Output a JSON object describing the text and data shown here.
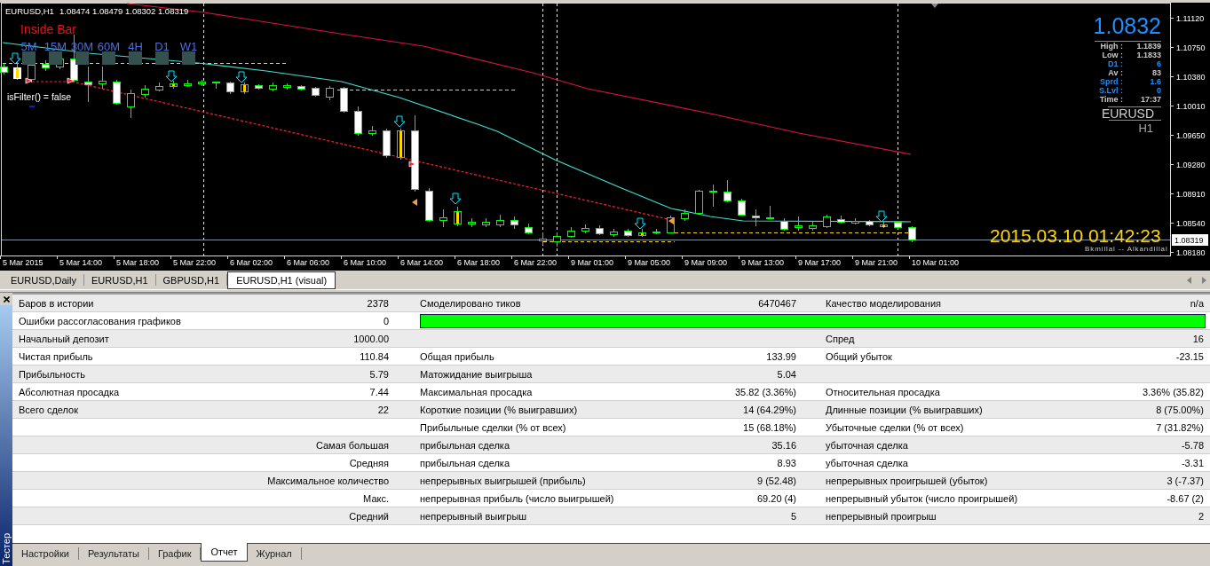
{
  "chart": {
    "symbol": "EURUSD,H1",
    "ohlc": "1.08474 1.08479 1.08302 1.08319",
    "indicator_title": "Inside Bar",
    "timeframes": [
      {
        "label": "5M"
      },
      {
        "label": "15M"
      },
      {
        "label": "30M"
      },
      {
        "label": "60M"
      },
      {
        "label": "4H"
      },
      {
        "label": "D1"
      },
      {
        "label": "W1"
      }
    ],
    "filter_status": "isFilter() = false",
    "info_panel": {
      "price": "1.0832",
      "rows": [
        {
          "label": "High :",
          "value": "1.1839",
          "color": "#c8c8c8"
        },
        {
          "label": "Low :",
          "value": "1.1833",
          "color": "#c8c8c8"
        },
        {
          "label": "D1 :",
          "value": "6",
          "color": "#1e90ff"
        },
        {
          "label": "Av :",
          "value": "83",
          "color": "#c8c8c8"
        },
        {
          "label": "Sprd :",
          "value": "1.6",
          "color": "#1e90ff"
        },
        {
          "label": "S.Lvl :",
          "value": "0",
          "color": "#1e90ff"
        },
        {
          "label": "Time :",
          "value": "17:37",
          "color": "#c8c8c8"
        }
      ],
      "symbol": "EURUSD",
      "period": "H1"
    },
    "datetime": "2015.03.10 01:42:23",
    "price_axis": [
      "1.11120",
      "1.10750",
      "1.10380",
      "1.10010",
      "1.09650",
      "1.09280",
      "1.08910",
      "1.08540",
      "1.08180"
    ],
    "current_price": "1.08319",
    "time_axis": [
      "5 Mar 2015",
      "5 Mar 14:00",
      "5 Mar 18:00",
      "5 Mar 22:00",
      "6 Mar 02:00",
      "6 Mar 06:00",
      "6 Mar 10:00",
      "6 Mar 14:00",
      "6 Mar 18:00",
      "6 Mar 22:00",
      "9 Mar 01:00",
      "9 Mar 05:00",
      "9 Mar 09:00",
      "9 Mar 13:00",
      "9 Mar 17:00",
      "9 Mar 21:00",
      "10 Mar 01:00"
    ],
    "footer_note": "Bkmillal -- Alkandillal"
  },
  "chart_tabs": [
    {
      "label": "EURUSD,Daily",
      "selected": false
    },
    {
      "label": "EURUSD,H1",
      "selected": false
    },
    {
      "label": "GBPUSD,H1",
      "selected": false
    },
    {
      "label": "EURUSD,H1 (visual)",
      "selected": true
    }
  ],
  "panel_title": "Тестер",
  "report": {
    "rows": [
      {
        "kind": "values",
        "column_1": "Баров в истории",
        "column_2": "2378",
        "column_3": "Смоделировано тиков",
        "column_4": "6470467",
        "column_5": "Качество моделирования",
        "column_6": "n/a"
      },
      {
        "kind": "quality_bar",
        "column_1": "Ошибки рассогласования графиков",
        "column_2": "0"
      },
      {
        "kind": "values",
        "column_1": "Начальный депозит",
        "column_2": "1000.00",
        "column_5": "Спред",
        "column_6": "16"
      },
      {
        "kind": "values",
        "column_1": "Чистая прибыль",
        "column_2": "110.84",
        "column_3": "Общая прибыль",
        "column_4": "133.99",
        "column_5": "Общий убыток",
        "column_6": "-23.15"
      },
      {
        "kind": "values",
        "column_1": "Прибыльность",
        "column_2": "5.79",
        "column_3": "Матожидание выигрыша",
        "column_4": "5.04"
      },
      {
        "kind": "values",
        "column_1": "Абсолютная просадка",
        "column_2": "7.44",
        "column_3": "Максимальная просадка",
        "column_4": "35.82 (3.36%)",
        "column_5": "Относительная просадка",
        "column_6": "3.36% (35.82)"
      },
      {
        "kind": "values",
        "column_1": "Всего сделок",
        "column_2": "22",
        "column_3": "Короткие позиции (% выигравших)",
        "column_4": "14 (64.29%)",
        "column_5": "Длинные позиции (% выигравших)",
        "column_6": "8 (75.00%)"
      },
      {
        "kind": "values",
        "column_3": "Прибыльные сделки (% от всех)",
        "column_4": "15 (68.18%)",
        "column_5": "Убыточные сделки (% от всех)",
        "column_6": "7 (31.82%)"
      },
      {
        "kind": "values",
        "column_2": "Самая большая",
        "column_3": "прибыльная сделка",
        "column_4": "35.16",
        "column_5": "убыточная сделка",
        "column_6": "-5.78"
      },
      {
        "kind": "values",
        "column_2": "Средняя",
        "column_3": "прибыльная сделка",
        "column_4": "8.93",
        "column_5": "убыточная сделка",
        "column_6": "-3.31"
      },
      {
        "kind": "values",
        "column_2": "Максимальное количество",
        "column_3": "непрерывных выигрышей (прибыль)",
        "column_4": "9 (52.48)",
        "column_5": "непрерывных проигрышей (убыток)",
        "column_6": "3 (-7.37)"
      },
      {
        "kind": "values",
        "column_2": "Макс.",
        "column_3": "непрерывная прибыль (число выигрышей)",
        "column_4": "69.20 (4)",
        "column_5": "непрерывный убыток (число проигрышей)",
        "column_6": "-8.67 (2)"
      },
      {
        "kind": "values",
        "column_2": "Средний",
        "column_3": "непрерывный выигрыш",
        "column_4": "5",
        "column_5": "непрерывный проигрыш",
        "column_6": "2"
      }
    ]
  },
  "tester_tabs": [
    {
      "label": "Настройки",
      "selected": false
    },
    {
      "label": "Результаты",
      "selected": false
    },
    {
      "label": "График",
      "selected": false
    },
    {
      "label": "Отчет",
      "selected": true
    },
    {
      "label": "Журнал",
      "selected": false
    }
  ]
}
